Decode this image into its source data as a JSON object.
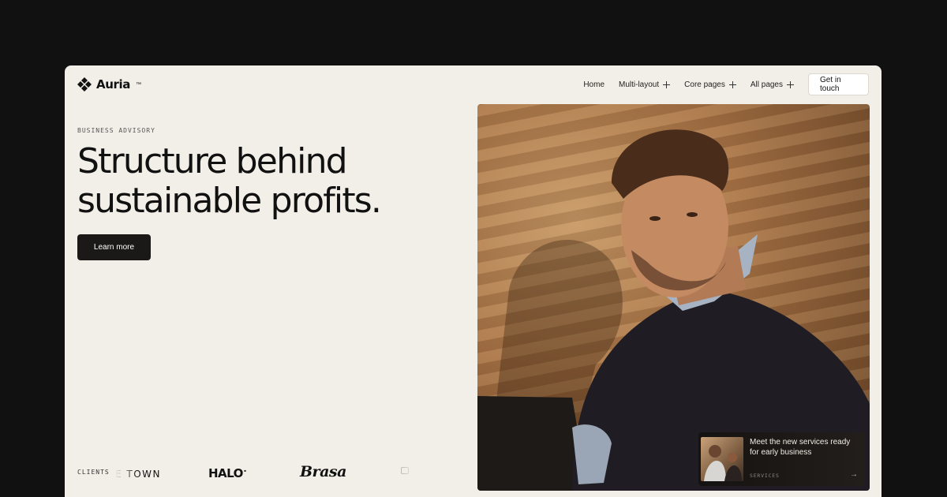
{
  "brand": {
    "name": "Auria",
    "trademark": "™"
  },
  "nav": {
    "items": [
      {
        "label": "Home",
        "has_plus": false
      },
      {
        "label": "Multi-layout",
        "has_plus": true
      },
      {
        "label": "Core pages",
        "has_plus": true
      },
      {
        "label": "All pages",
        "has_plus": true
      }
    ],
    "cta_label": "Get in touch"
  },
  "hero": {
    "eyebrow": "BUSINESS ADVISORY",
    "headline_line1": "Structure behind",
    "headline_line2": "sustainable profits.",
    "button_label": "Learn more"
  },
  "clients": {
    "label": "CLIENTS",
    "logos": {
      "town": "E TOWN",
      "halo": "HALO",
      "brasa": "Brasa"
    }
  },
  "promo": {
    "title": "Meet the new services ready for early business",
    "tag": "SERVICES",
    "arrow": "→"
  },
  "colors": {
    "page_bg": "#111111",
    "frame_bg": "#f2efe8",
    "button_dark": "#1a1918"
  }
}
